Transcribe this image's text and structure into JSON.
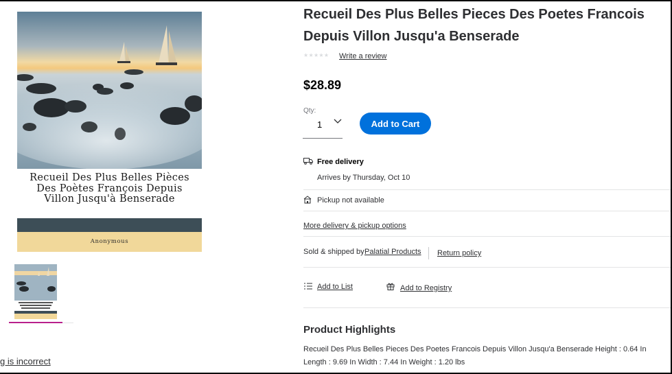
{
  "product": {
    "title": "Recueil Des Plus Belles Pieces Des Poetes Francois Depuis Villon Jusqu'a Benserade",
    "stars": "★★★★★",
    "write_review": "Write a review",
    "price": "$28.89",
    "rating_star_color": "#dadcdf"
  },
  "cover": {
    "title_lines": [
      "Recueil Des Plus Belles Pièces",
      "Des Poètes François Depuis",
      "Villon Jusqu'à Benserade"
    ],
    "author": "Anonymous",
    "band_color": "#3d4e57",
    "author_band_color": "#f1d89a"
  },
  "quantity": {
    "label": "Qty:",
    "value": "1"
  },
  "cart": {
    "add_label": "Add to Cart",
    "button_color": "#0071dc"
  },
  "fulfillment": {
    "delivery_title": "Free delivery",
    "arrives": "Arrives by Thursday, Oct 10",
    "pickup": "Pickup not available",
    "more_options": "More delivery & pickup options"
  },
  "seller": {
    "sold_by_label": "Sold & shipped by",
    "name": "Palatial Products",
    "return_policy": "Return policy"
  },
  "actions": {
    "add_to_list": "Add to List",
    "add_to_registry": "Add to Registry"
  },
  "highlights": {
    "heading": "Product Highlights",
    "text": "Recueil Des Plus Belles Pieces Des Poetes Francois Depuis Villon Jusqu'a Benserade Height : 0.64 In Length : 9.69 In Width : 7.44 In Weight : 1.20 lbs"
  },
  "report": {
    "label": "g is incorrect"
  },
  "accent": {
    "thumbnail_selected_color": "#b8208c"
  }
}
